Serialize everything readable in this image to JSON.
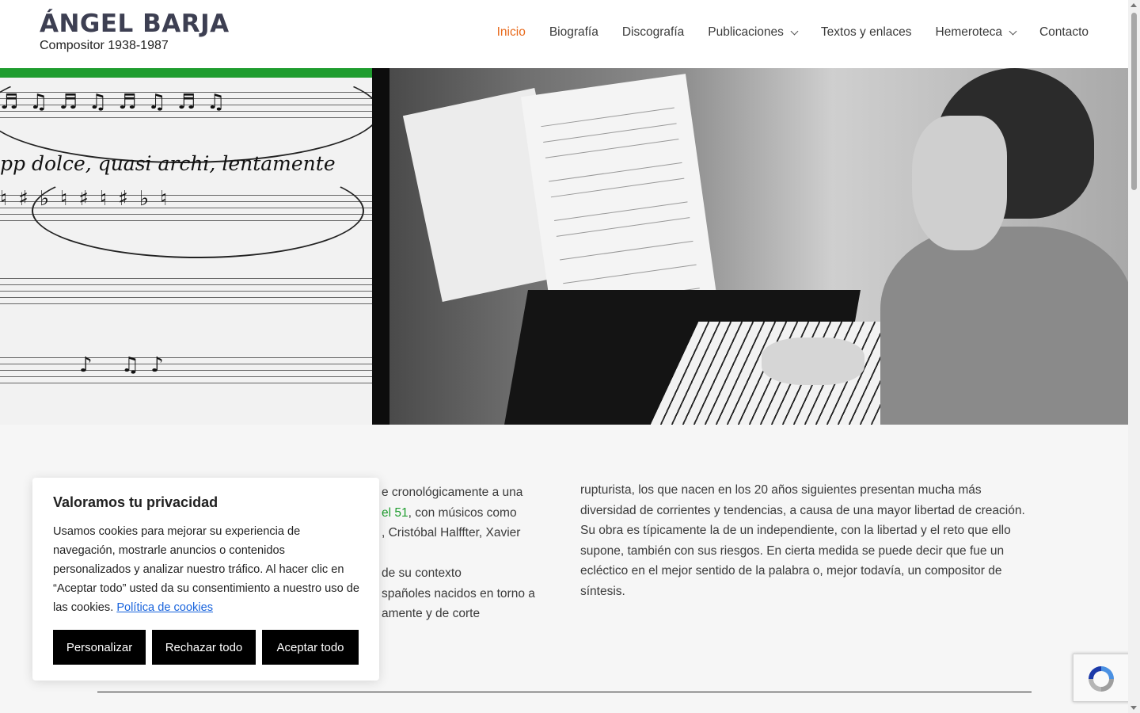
{
  "site": {
    "title": "ÁNGEL BARJA",
    "tagline": "Compositor 1938-1987"
  },
  "nav": {
    "items": [
      {
        "label": "Inicio",
        "active": true,
        "has_dropdown": false
      },
      {
        "label": "Biografía",
        "active": false,
        "has_dropdown": false
      },
      {
        "label": "Discografía",
        "active": false,
        "has_dropdown": false
      },
      {
        "label": "Publicaciones",
        "active": false,
        "has_dropdown": true
      },
      {
        "label": "Textos y enlaces",
        "active": false,
        "has_dropdown": false
      },
      {
        "label": "Hemeroteca",
        "active": false,
        "has_dropdown": true
      },
      {
        "label": "Contacto",
        "active": false,
        "has_dropdown": false
      }
    ]
  },
  "hero": {
    "score_text": "pp dolce, quasi archi, lentamente",
    "score_top_text": "lentamente"
  },
  "content": {
    "left_lines": [
      {
        "pre": "e cronológicamente a una",
        "link": "",
        "post": ""
      },
      {
        "pre": "",
        "link": "el 51",
        "post": ", con músicos como"
      },
      {
        "pre": ", Cristóbal Halffter, Xavier",
        "link": "",
        "post": ""
      },
      {
        "pre": "",
        "link": "",
        "post": ""
      },
      {
        "pre": " de su contexto",
        "link": "",
        "post": ""
      },
      {
        "pre": "spañoles nacidos en torno a",
        "link": "",
        "post": ""
      },
      {
        "pre": "amente y de corte",
        "link": "",
        "post": ""
      }
    ],
    "right_p1": "rupturista, los que nacen en los 20 años siguientes presentan mucha más diversidad de corrientes y tendencias, a causa de una mayor libertad de creación.",
    "right_p2": "Su obra es típicamente la de un independiente, con la libertad y el reto que ello supone, también con sus riesgos. En cierta medida se puede decir que fue un ecléctico en el mejor sentido de la palabra o, mejor todavía, un compositor de síntesis."
  },
  "cookie": {
    "title": "Valoramos tu privacidad",
    "body": "Usamos cookies para mejorar su experiencia de navegación, mostrarle anuncios o contenidos personalizados y analizar nuestro tráfico. Al hacer clic en “Aceptar todo” usted da su consentimiento a nuestro uso de las cookies.",
    "link": "Política de cookies",
    "buttons": {
      "customize": "Personalizar",
      "reject": "Rechazar todo",
      "accept": "Aceptar todo"
    }
  },
  "colors": {
    "accent_orange": "#e86a1c",
    "link_green": "#1f9d2f",
    "cookie_link_blue": "#1863dc",
    "site_title": "#3d3f52"
  },
  "icons": {
    "recaptcha": "recaptcha-icon",
    "dropdown": "chevron-down-icon"
  }
}
